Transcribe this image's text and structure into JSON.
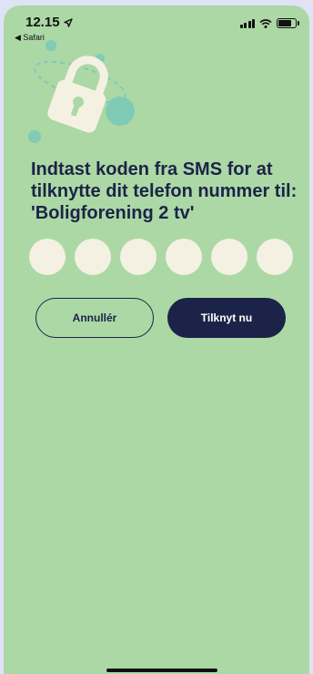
{
  "status": {
    "time": "12.15",
    "back_app": "◀ Safari"
  },
  "heading": "Indtast koden fra SMS for at tilknytte dit telefon nummer til: 'Boligforening 2 tv'",
  "code_fields": [
    "",
    "",
    "",
    "",
    "",
    ""
  ],
  "buttons": {
    "cancel": "Annullér",
    "confirm": "Tilknyt nu"
  },
  "colors": {
    "background": "#acd8a5",
    "primary": "#1c2348",
    "field": "#f4f1e3",
    "accent": "#7fcbb5"
  },
  "icons": [
    "location-arrow-icon",
    "signal-icon",
    "wifi-icon",
    "battery-icon",
    "padlock-illustration"
  ]
}
